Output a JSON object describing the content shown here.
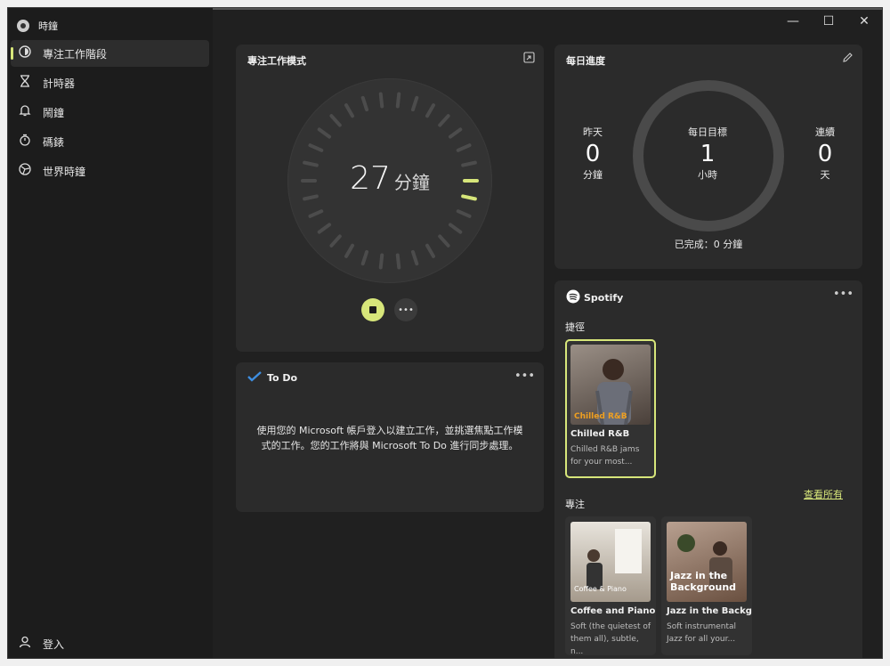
{
  "app": {
    "title": "時鐘"
  },
  "window_buttons": {
    "minimize": "—",
    "maximize": "☐",
    "close": "✕"
  },
  "sidebar": {
    "items": [
      {
        "label": "專注工作階段",
        "icon": "focus-icon",
        "active": true
      },
      {
        "label": "計時器",
        "icon": "hourglass-icon",
        "active": false
      },
      {
        "label": "鬧鐘",
        "icon": "bell-icon",
        "active": false
      },
      {
        "label": "碼錶",
        "icon": "stopwatch-icon",
        "active": false
      },
      {
        "label": "世界時鐘",
        "icon": "globe-icon",
        "active": false
      }
    ],
    "signin_label": "登入"
  },
  "focus": {
    "title": "專注工作模式",
    "minutes": "27",
    "unit": "分鐘",
    "progress_fraction": 0.07
  },
  "daily": {
    "title": "每日進度",
    "yesterday": {
      "label": "昨天",
      "value": "0",
      "unit": "分鐘"
    },
    "goal": {
      "label": "每日目標",
      "value": "1",
      "unit": "小時"
    },
    "streak": {
      "label": "連續",
      "value": "0",
      "unit": "天"
    },
    "completed": "已完成：0 分鐘"
  },
  "todo": {
    "title": "To Do",
    "message": "使用您的 Microsoft 帳戶登入以建立工作，並挑選焦點工作模式的工作。您的工作將與 Microsoft To Do 進行同步處理。"
  },
  "spotify": {
    "title": "Spotify",
    "shortcuts_label": "捷徑",
    "focus_label": "專注",
    "view_all": "查看所有",
    "shortcut": {
      "name": "Chilled R&B",
      "art_text": "Chilled R&B",
      "desc": "Chilled R&B jams for your most..."
    },
    "focus_items": [
      {
        "name": "Coffee and Piano",
        "art_text": "Coffee & Piano",
        "desc": "Soft (the quietest of them all), subtle, n..."
      },
      {
        "name": "Jazz in the Backg...",
        "art_text": "Jazz in the Background",
        "desc": "Soft instrumental Jazz for all your..."
      }
    ]
  },
  "colors": {
    "accent": "#d7e67a",
    "card": "#2b2b2b",
    "background": "#202020"
  }
}
